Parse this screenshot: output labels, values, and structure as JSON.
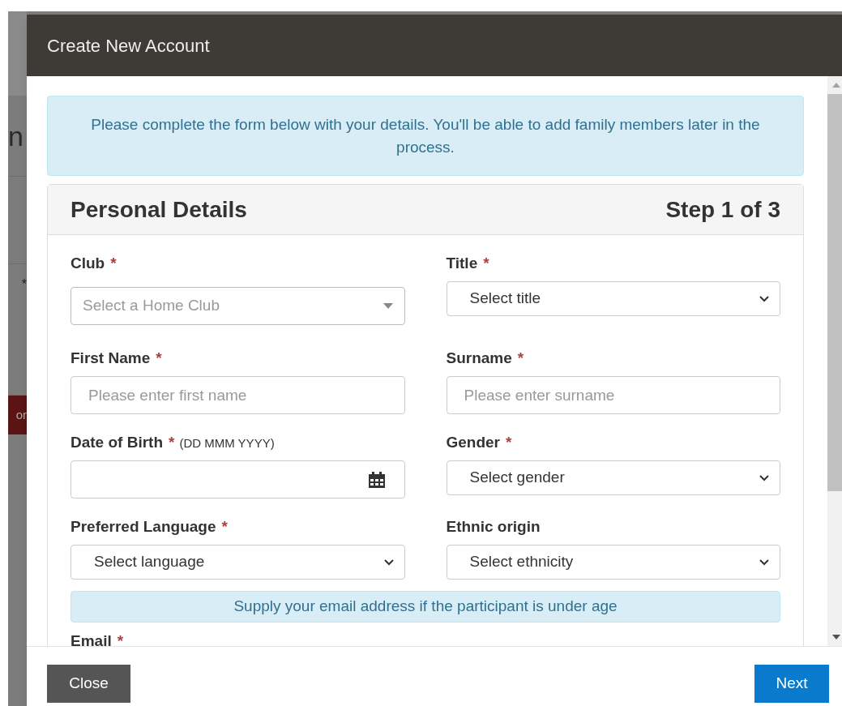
{
  "background": {
    "heading_fragment": "n",
    "label_fragment": "*",
    "button_fragment": "or"
  },
  "dialog": {
    "title": "Create New Account",
    "notice": "Please complete the form below with your details. You'll be able to add family members later in the process.",
    "panel": {
      "title": "Personal Details",
      "step": "Step 1 of 3",
      "fields": [
        {
          "kind": "select2",
          "label": "Club",
          "required_mark": "*",
          "placeholder": "Select a Home Club"
        },
        {
          "kind": "select",
          "label": "Title",
          "required_mark": "*",
          "placeholder": "Select title"
        },
        {
          "kind": "text",
          "label": "First Name",
          "required_mark": "*",
          "placeholder": "Please enter first name"
        },
        {
          "kind": "text",
          "label": "Surname",
          "required_mark": "*",
          "placeholder": "Please enter surname"
        },
        {
          "kind": "date",
          "label": "Date of Birth",
          "required_mark": "*",
          "hint": "(DD MMM YYYY)"
        },
        {
          "kind": "select",
          "label": "Gender",
          "required_mark": "*",
          "placeholder": "Select gender"
        },
        {
          "kind": "select",
          "label": "Preferred Language",
          "required_mark": "*",
          "placeholder": "Select language"
        },
        {
          "kind": "select",
          "label": "Ethnic origin",
          "placeholder": "Select ethnicity"
        }
      ],
      "email_notice": "Supply your email address if the participant is under age",
      "email_field": {
        "label": "Email",
        "required_mark": "*"
      }
    },
    "buttons": [
      {
        "kind": "secondary",
        "label": "Close"
      },
      {
        "kind": "primary",
        "label": "Next"
      }
    ]
  }
}
